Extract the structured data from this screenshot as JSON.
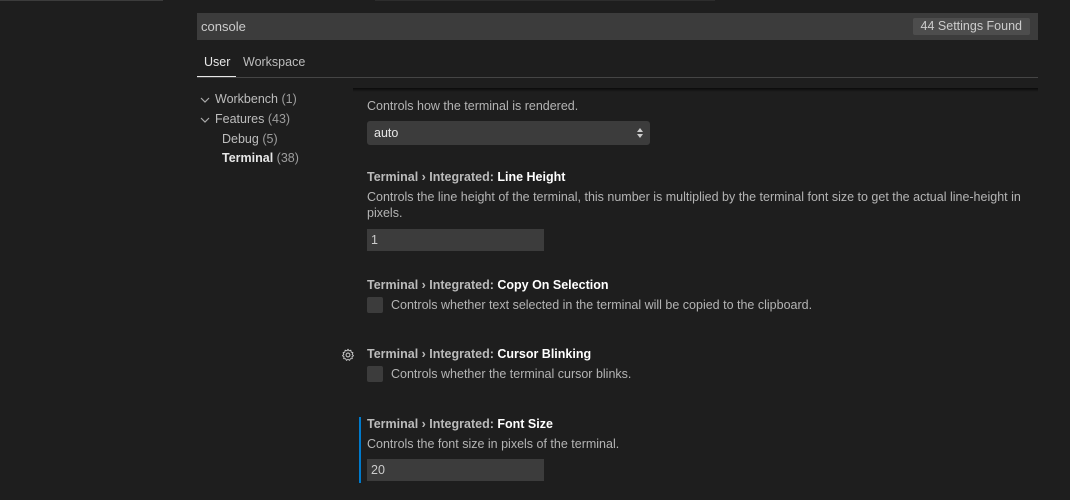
{
  "search": {
    "value": "console",
    "results": "44 Settings Found"
  },
  "tabs": [
    {
      "label": "User"
    },
    {
      "label": "Workspace"
    }
  ],
  "toc": [
    {
      "label": "Workbench",
      "count": "(1)",
      "expanded": true
    },
    {
      "label": "Features",
      "count": "(43)",
      "expanded": true
    },
    {
      "label": "Debug",
      "count": "(5)"
    },
    {
      "label": "Terminal",
      "count": "(38)",
      "active": true
    }
  ],
  "settings": {
    "renderer": {
      "description": "Controls how the terminal is rendered.",
      "value": "auto"
    },
    "line_height": {
      "prefix": "Terminal › Integrated: ",
      "name": "Line Height",
      "description": "Controls the line height of the terminal, this number is multiplied by the terminal font size to get the actual line-height in pixels.",
      "value": "1"
    },
    "copy_on_selection": {
      "prefix": "Terminal › Integrated: ",
      "name": "Copy On Selection",
      "description": "Controls whether text selected in the terminal will be copied to the clipboard."
    },
    "cursor_blinking": {
      "prefix": "Terminal › Integrated: ",
      "name": "Cursor Blinking",
      "description": "Controls whether the terminal cursor blinks."
    },
    "font_size": {
      "prefix": "Terminal › Integrated: ",
      "name": "Font Size",
      "description": "Controls the font size in pixels of the terminal.",
      "value": "20"
    }
  },
  "icons": {
    "settings_gear": "gear-icon",
    "tree_toggle": "chevron-down-icon",
    "select_arrows": "select-arrows-icon"
  },
  "colors": {
    "background": "#1e1e1e",
    "input": "#3c3c3c",
    "focus_accent": "#007acc"
  }
}
